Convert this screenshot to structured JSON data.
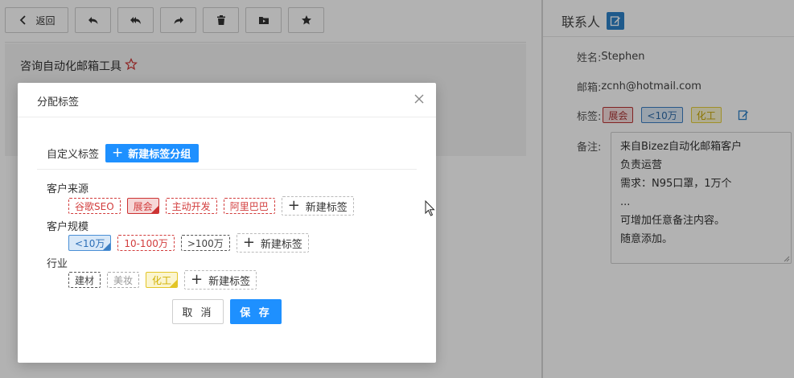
{
  "toolbar": {
    "back_label": "返回",
    "buttons": [
      "reply-icon",
      "reply-all-icon",
      "forward-icon",
      "trash-icon",
      "move-folder-icon",
      "star-icon"
    ]
  },
  "mail": {
    "subject": "咨询自动化邮箱工具"
  },
  "contact": {
    "header": "联系人",
    "name_label": "姓名:",
    "name_value": "Stephen",
    "email_label": "邮箱:",
    "email_value": "zcnh@hotmail.com",
    "tags_label": "标签:",
    "tags": [
      {
        "label": "展会",
        "color": "red"
      },
      {
        "label": "<10万",
        "color": "blue"
      },
      {
        "label": "化工",
        "color": "yellow"
      }
    ],
    "notes_label": "备注:",
    "notes": "来自Bizez自动化邮箱客户\n负责运营\n需求：N95口罩，1万个\n...\n可增加任意备注内容。\n随意添加。"
  },
  "modal": {
    "title": "分配标签",
    "custom_label": "自定义标签",
    "new_group_label": "新建标签分组",
    "new_tag_label": "新建标签",
    "groups": [
      {
        "name": "客户来源",
        "tags": [
          {
            "label": "谷歌SEO",
            "style": "red",
            "selected": false
          },
          {
            "label": "展会",
            "style": "red",
            "selected": true
          },
          {
            "label": "主动开发",
            "style": "red",
            "selected": false
          },
          {
            "label": "阿里巴巴",
            "style": "red",
            "selected": false
          }
        ]
      },
      {
        "name": "客户规模",
        "tags": [
          {
            "label": "<10万",
            "style": "blue",
            "selected": true
          },
          {
            "label": "10-100万",
            "style": "red",
            "selected": false
          },
          {
            "label": ">100万",
            "style": "dark",
            "selected": false
          }
        ]
      },
      {
        "name": "行业",
        "tags": [
          {
            "label": "建材",
            "style": "dark",
            "selected": false
          },
          {
            "label": "美妆",
            "style": "gray",
            "selected": false
          },
          {
            "label": "化工",
            "style": "yellow",
            "selected": true
          }
        ]
      }
    ],
    "cancel_label": "取 消",
    "save_label": "保 存"
  },
  "colors": {
    "primary": "#1e90ff",
    "edit_badge": "#2d82c8",
    "tag_red": "#d23c3c",
    "tag_blue": "#3b7fc4",
    "tag_yellow": "#e3c526"
  }
}
